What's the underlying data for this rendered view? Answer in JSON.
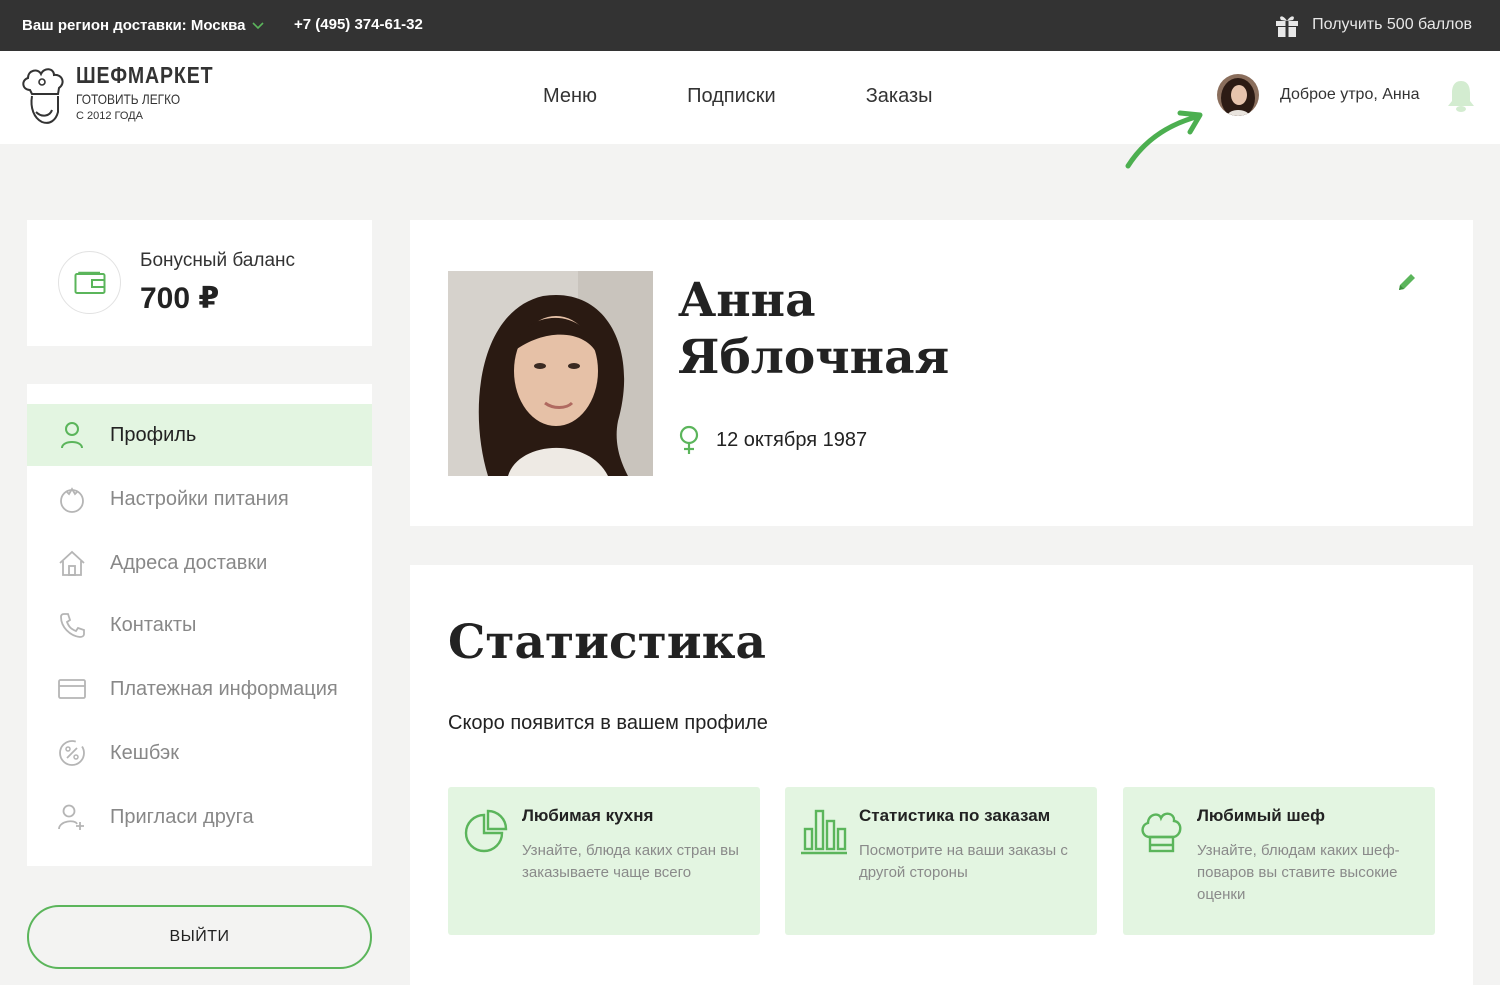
{
  "topbar": {
    "region": "Ваш регион доставки: Москва",
    "phone": "+7 (495) 374-61-32",
    "bonus_link": "Получить 500 баллов"
  },
  "logo": {
    "title": "ШЕФМАРКЕТ",
    "subtitle": "ГОТОВИТЬ ЛЕГКО",
    "since": "С 2012 ГОДА"
  },
  "nav": {
    "items": [
      {
        "label": "Меню"
      },
      {
        "label": "Подписки"
      },
      {
        "label": "Заказы"
      }
    ]
  },
  "user": {
    "greeting": "Доброе утро, Анна"
  },
  "balance": {
    "label": "Бонусный баланс",
    "value": "700 ₽"
  },
  "sidebar": {
    "items": [
      {
        "label": "Профиль",
        "icon": "user-icon",
        "active": true
      },
      {
        "label": "Настройки питания",
        "icon": "tomato-icon"
      },
      {
        "label": "Адреса доставки",
        "icon": "home-icon"
      },
      {
        "label": "Контакты",
        "icon": "phone-icon"
      },
      {
        "label": "Платежная информация",
        "icon": "card-icon"
      },
      {
        "label": "Кешбэк",
        "icon": "cashback-icon"
      },
      {
        "label": "Пригласи друга",
        "icon": "invite-icon"
      }
    ],
    "logout": "ВЫЙТИ"
  },
  "profile": {
    "first_name": "Анна",
    "last_name": "Яблочная",
    "birth_date": "12 октября 1987"
  },
  "stats": {
    "title": "Статистика",
    "subtitle": "Скоро появится в вашем профиле",
    "tiles": [
      {
        "title": "Любимая кухня",
        "desc": "Узнайте, блюда каких стран вы заказываете чаще всего",
        "icon": "pie-chart-icon"
      },
      {
        "title": "Статистика по заказам",
        "desc": "Посмотрите на ваши заказы с другой стороны",
        "icon": "bar-chart-icon"
      },
      {
        "title": "Любимый шеф",
        "desc": "Узнайте, блюдам каких шеф-поваров вы ставите высокие оценки",
        "icon": "chef-hat-icon"
      }
    ]
  },
  "colors": {
    "accent": "#5bb55b",
    "topbar_bg": "#333333",
    "tile_bg": "#e3f5e1",
    "page_bg": "#f3f3f2"
  }
}
